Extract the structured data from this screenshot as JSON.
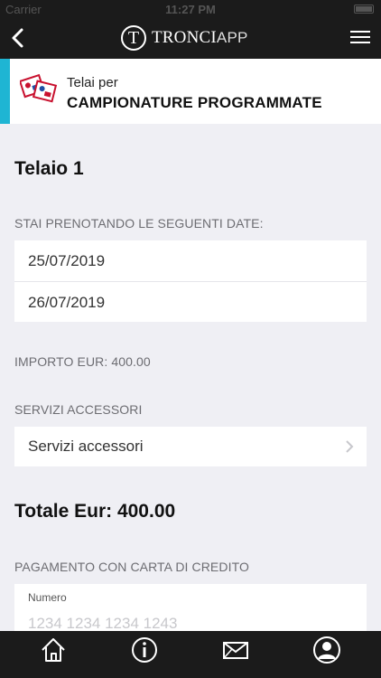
{
  "status_bar": {
    "carrier": "Carrier",
    "time": "11:27 PM"
  },
  "nav": {
    "logo_letter": "T",
    "logo_bold": "TRONCI",
    "logo_light": "APP"
  },
  "header": {
    "subtitle": "Telai per",
    "title": "CAMPIONATURE PROGRAMMATE"
  },
  "frame_title": "Telaio 1",
  "dates_label": "STAI PRENOTANDO LE SEGUENTI DATE:",
  "dates": [
    "25/07/2019",
    "26/07/2019"
  ],
  "amount_label": "IMPORTO EUR: 400.00",
  "services": {
    "label": "SERVIZI ACCESSORI",
    "value": "Servizi accessori"
  },
  "total": "Totale Eur: 400.00",
  "payment": {
    "label": "PAGAMENTO CON CARTA DI CREDITO",
    "field_label": "Numero",
    "field_placeholder": "1234 1234 1234 1243"
  },
  "tab_bar": {
    "icons": [
      "home-icon",
      "info-icon",
      "mail-icon",
      "profile-icon"
    ]
  },
  "colors": {
    "accent": "#1fb5d3",
    "bar": "#1b1b1b",
    "background": "#efeff4"
  }
}
